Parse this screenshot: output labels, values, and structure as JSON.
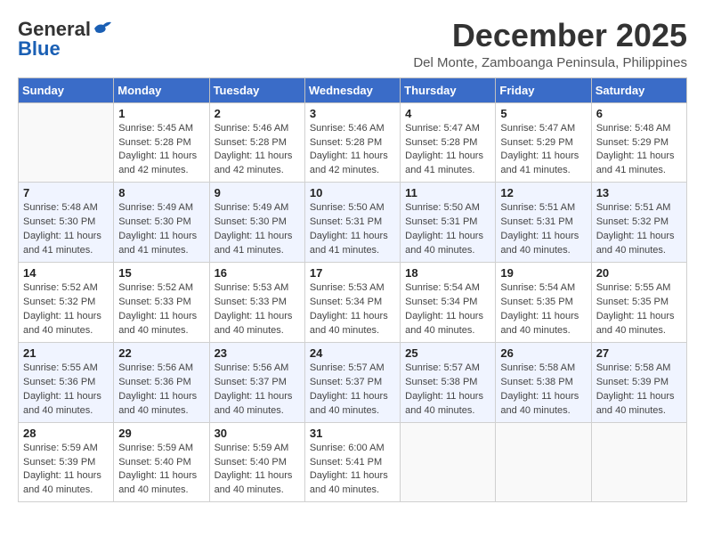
{
  "header": {
    "logo_general": "General",
    "logo_blue": "Blue",
    "month": "December 2025",
    "location": "Del Monte, Zamboanga Peninsula, Philippines"
  },
  "days_of_week": [
    "Sunday",
    "Monday",
    "Tuesday",
    "Wednesday",
    "Thursday",
    "Friday",
    "Saturday"
  ],
  "weeks": [
    [
      {
        "num": "",
        "info": ""
      },
      {
        "num": "1",
        "info": "Sunrise: 5:45 AM\nSunset: 5:28 PM\nDaylight: 11 hours\nand 42 minutes."
      },
      {
        "num": "2",
        "info": "Sunrise: 5:46 AM\nSunset: 5:28 PM\nDaylight: 11 hours\nand 42 minutes."
      },
      {
        "num": "3",
        "info": "Sunrise: 5:46 AM\nSunset: 5:28 PM\nDaylight: 11 hours\nand 42 minutes."
      },
      {
        "num": "4",
        "info": "Sunrise: 5:47 AM\nSunset: 5:28 PM\nDaylight: 11 hours\nand 41 minutes."
      },
      {
        "num": "5",
        "info": "Sunrise: 5:47 AM\nSunset: 5:29 PM\nDaylight: 11 hours\nand 41 minutes."
      },
      {
        "num": "6",
        "info": "Sunrise: 5:48 AM\nSunset: 5:29 PM\nDaylight: 11 hours\nand 41 minutes."
      }
    ],
    [
      {
        "num": "7",
        "info": "Sunrise: 5:48 AM\nSunset: 5:30 PM\nDaylight: 11 hours\nand 41 minutes."
      },
      {
        "num": "8",
        "info": "Sunrise: 5:49 AM\nSunset: 5:30 PM\nDaylight: 11 hours\nand 41 minutes."
      },
      {
        "num": "9",
        "info": "Sunrise: 5:49 AM\nSunset: 5:30 PM\nDaylight: 11 hours\nand 41 minutes."
      },
      {
        "num": "10",
        "info": "Sunrise: 5:50 AM\nSunset: 5:31 PM\nDaylight: 11 hours\nand 41 minutes."
      },
      {
        "num": "11",
        "info": "Sunrise: 5:50 AM\nSunset: 5:31 PM\nDaylight: 11 hours\nand 40 minutes."
      },
      {
        "num": "12",
        "info": "Sunrise: 5:51 AM\nSunset: 5:31 PM\nDaylight: 11 hours\nand 40 minutes."
      },
      {
        "num": "13",
        "info": "Sunrise: 5:51 AM\nSunset: 5:32 PM\nDaylight: 11 hours\nand 40 minutes."
      }
    ],
    [
      {
        "num": "14",
        "info": "Sunrise: 5:52 AM\nSunset: 5:32 PM\nDaylight: 11 hours\nand 40 minutes."
      },
      {
        "num": "15",
        "info": "Sunrise: 5:52 AM\nSunset: 5:33 PM\nDaylight: 11 hours\nand 40 minutes."
      },
      {
        "num": "16",
        "info": "Sunrise: 5:53 AM\nSunset: 5:33 PM\nDaylight: 11 hours\nand 40 minutes."
      },
      {
        "num": "17",
        "info": "Sunrise: 5:53 AM\nSunset: 5:34 PM\nDaylight: 11 hours\nand 40 minutes."
      },
      {
        "num": "18",
        "info": "Sunrise: 5:54 AM\nSunset: 5:34 PM\nDaylight: 11 hours\nand 40 minutes."
      },
      {
        "num": "19",
        "info": "Sunrise: 5:54 AM\nSunset: 5:35 PM\nDaylight: 11 hours\nand 40 minutes."
      },
      {
        "num": "20",
        "info": "Sunrise: 5:55 AM\nSunset: 5:35 PM\nDaylight: 11 hours\nand 40 minutes."
      }
    ],
    [
      {
        "num": "21",
        "info": "Sunrise: 5:55 AM\nSunset: 5:36 PM\nDaylight: 11 hours\nand 40 minutes."
      },
      {
        "num": "22",
        "info": "Sunrise: 5:56 AM\nSunset: 5:36 PM\nDaylight: 11 hours\nand 40 minutes."
      },
      {
        "num": "23",
        "info": "Sunrise: 5:56 AM\nSunset: 5:37 PM\nDaylight: 11 hours\nand 40 minutes."
      },
      {
        "num": "24",
        "info": "Sunrise: 5:57 AM\nSunset: 5:37 PM\nDaylight: 11 hours\nand 40 minutes."
      },
      {
        "num": "25",
        "info": "Sunrise: 5:57 AM\nSunset: 5:38 PM\nDaylight: 11 hours\nand 40 minutes."
      },
      {
        "num": "26",
        "info": "Sunrise: 5:58 AM\nSunset: 5:38 PM\nDaylight: 11 hours\nand 40 minutes."
      },
      {
        "num": "27",
        "info": "Sunrise: 5:58 AM\nSunset: 5:39 PM\nDaylight: 11 hours\nand 40 minutes."
      }
    ],
    [
      {
        "num": "28",
        "info": "Sunrise: 5:59 AM\nSunset: 5:39 PM\nDaylight: 11 hours\nand 40 minutes."
      },
      {
        "num": "29",
        "info": "Sunrise: 5:59 AM\nSunset: 5:40 PM\nDaylight: 11 hours\nand 40 minutes."
      },
      {
        "num": "30",
        "info": "Sunrise: 5:59 AM\nSunset: 5:40 PM\nDaylight: 11 hours\nand 40 minutes."
      },
      {
        "num": "31",
        "info": "Sunrise: 6:00 AM\nSunset: 5:41 PM\nDaylight: 11 hours\nand 40 minutes."
      },
      {
        "num": "",
        "info": ""
      },
      {
        "num": "",
        "info": ""
      },
      {
        "num": "",
        "info": ""
      }
    ]
  ]
}
